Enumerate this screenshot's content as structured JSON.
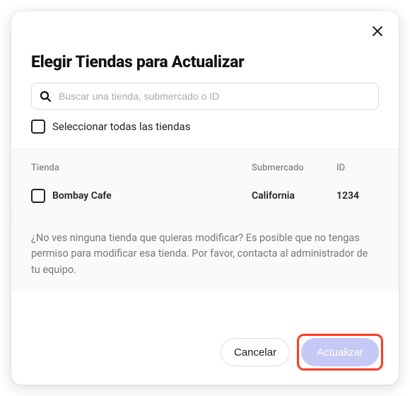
{
  "modal": {
    "title": "Elegir Tiendas para Actualizar",
    "search_placeholder": "Buscar una tienda, submercado o ID",
    "select_all_label": "Seleccionar todas las tiendas",
    "help_text": "¿No ves ninguna tienda que quieras modificar? Es posible que no tengas permiso para modificar esa tienda. Por favor, contacta al administrador de tu equipo."
  },
  "table": {
    "headers": {
      "store": "Tienda",
      "submarket": "Submercado",
      "id": "ID"
    },
    "rows": [
      {
        "name": "Bombay Cafe",
        "submarket": "California",
        "id": "1234"
      }
    ]
  },
  "footer": {
    "cancel_label": "Cancelar",
    "update_label": "Actualizar"
  }
}
